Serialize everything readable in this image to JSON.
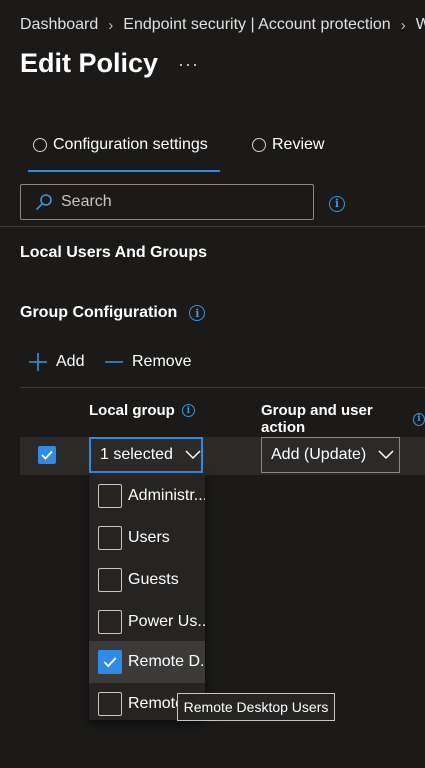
{
  "breadcrumb": {
    "items": [
      "Dashboard",
      "Endpoint security | Account protection",
      "W"
    ],
    "separator": "›"
  },
  "page": {
    "title": "Edit Policy",
    "more_label": "···"
  },
  "tabs": [
    {
      "label": "Configuration settings",
      "active": true
    },
    {
      "label": "Review",
      "active": false
    }
  ],
  "search": {
    "placeholder": "Search"
  },
  "sections": {
    "local_users": "Local Users And Groups",
    "group_config": "Group Configuration"
  },
  "actions": {
    "add_label": "Add",
    "remove_label": "Remove"
  },
  "table": {
    "columns": [
      "Local group",
      "Group and user action"
    ],
    "row": {
      "checked": true,
      "local_group_value": "1 selected",
      "action_value": "Add (Update)"
    }
  },
  "local_group_options": [
    {
      "label": "Administr...",
      "checked": false
    },
    {
      "label": "Users",
      "checked": false
    },
    {
      "label": "Guests",
      "checked": false
    },
    {
      "label": "Power Us...",
      "checked": false
    },
    {
      "label": "Remote D...",
      "checked": true
    },
    {
      "label": "Remote...",
      "checked": false
    }
  ],
  "tooltip": {
    "text": "Remote Desktop Users"
  },
  "colors": {
    "accent": "#2f8ce6",
    "background": "#1b1a19",
    "info": "#3a96dd"
  }
}
